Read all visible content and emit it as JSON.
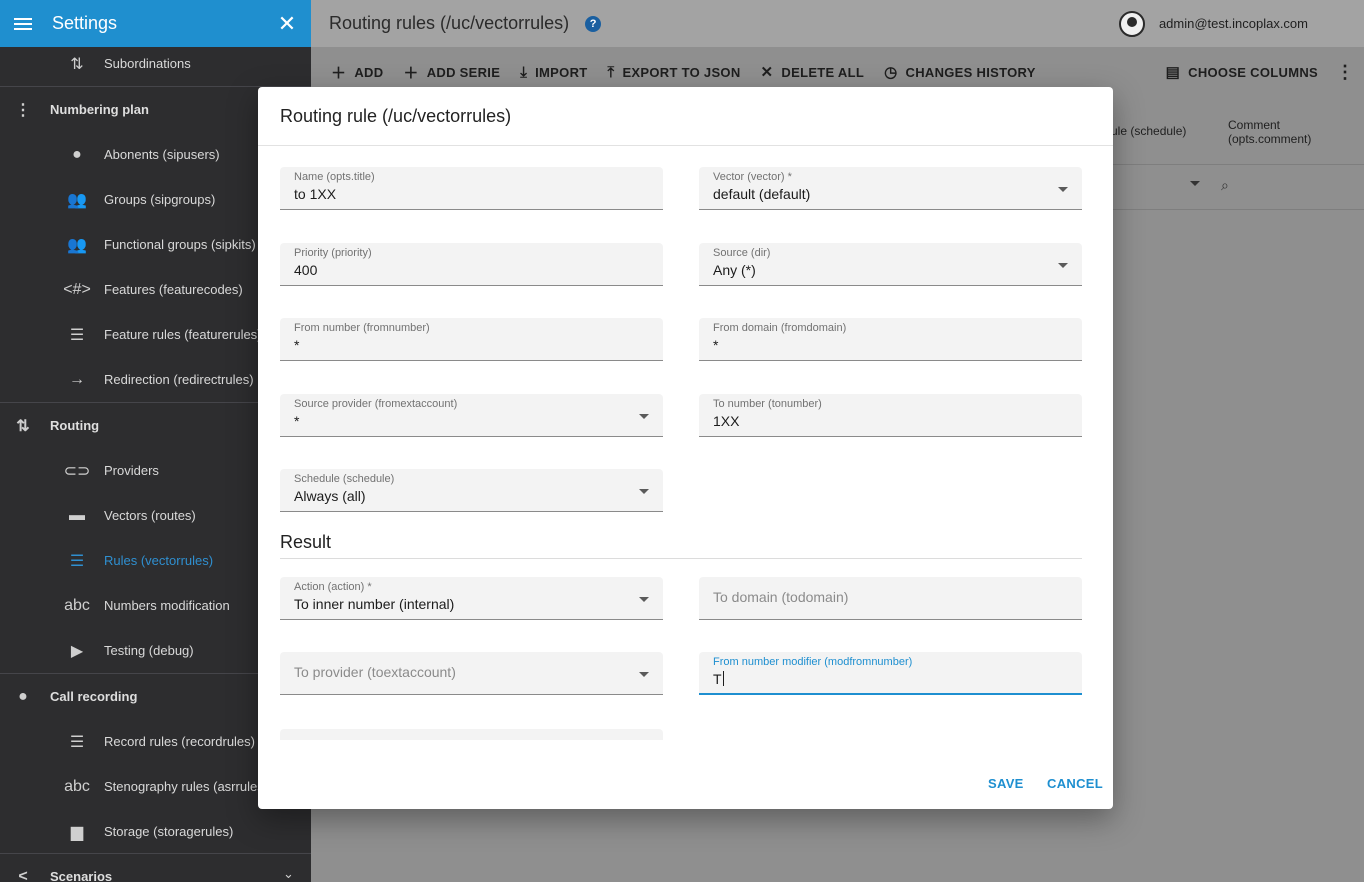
{
  "sidebar": {
    "title": "Settings",
    "items": [
      {
        "kind": "item",
        "label": "Subordinations",
        "icon": "sort-arrows-icon",
        "glyph": "⇅"
      },
      {
        "kind": "section",
        "label": "Numbering plan",
        "icon": "more-vertical-icon",
        "glyph": "⋮"
      },
      {
        "kind": "item",
        "label": "Abonents (sipusers)",
        "icon": "person-icon",
        "glyph": "●"
      },
      {
        "kind": "item",
        "label": "Groups (sipgroups)",
        "icon": "people-icon",
        "glyph": "👥"
      },
      {
        "kind": "item",
        "label": "Functional groups (sipkits)",
        "icon": "people-icon",
        "glyph": "👥"
      },
      {
        "kind": "item",
        "label": "Features (featurecodes)",
        "icon": "code-hash-icon",
        "glyph": "<#>"
      },
      {
        "kind": "item",
        "label": "Feature rules (featurerules)",
        "icon": "list-icon",
        "glyph": "☰"
      },
      {
        "kind": "item",
        "label": "Redirection (redirectrules)",
        "icon": "arrow-right-icon",
        "glyph": "→"
      },
      {
        "kind": "section",
        "label": "Routing",
        "icon": "sort-arrows-icon",
        "glyph": "⇅"
      },
      {
        "kind": "item",
        "label": "Providers",
        "icon": "link-icon",
        "glyph": "⊂⊃"
      },
      {
        "kind": "item",
        "label": "Vectors (routes)",
        "icon": "label-icon",
        "glyph": "▬"
      },
      {
        "kind": "item",
        "label": "Rules (vectorrules)",
        "icon": "list-icon",
        "glyph": "☰",
        "active": true
      },
      {
        "kind": "item",
        "label": "Numbers modification",
        "icon": "abc-icon",
        "glyph": "abc"
      },
      {
        "kind": "item",
        "label": "Testing (debug)",
        "icon": "play-circle-icon",
        "glyph": "▶"
      },
      {
        "kind": "section",
        "label": "Call recording",
        "icon": "record-icon",
        "glyph": "●"
      },
      {
        "kind": "item",
        "label": "Record rules (recordrules)",
        "icon": "list-icon",
        "glyph": "☰"
      },
      {
        "kind": "item",
        "label": "Stenography rules (asrrules)",
        "icon": "abc-icon",
        "glyph": "abc"
      },
      {
        "kind": "item",
        "label": "Storage (storagerules)",
        "icon": "storage-icon",
        "glyph": "▆"
      },
      {
        "kind": "section",
        "label": "Scenarios",
        "icon": "share-icon",
        "glyph": "<"
      }
    ]
  },
  "header": {
    "page_title": "Routing rules (/uc/vectorrules)",
    "help": "?",
    "user": "admin@test.incoplax.com"
  },
  "toolbar": {
    "add": "ADD",
    "add_serie": "ADD SERIE",
    "import": "IMPORT",
    "export": "EXPORT TO JSON",
    "delete_all": "DELETE ALL",
    "changes_history": "CHANGES HISTORY",
    "choose_columns": "CHOOSE COLUMNS"
  },
  "table": {
    "col_schedule": "ule (schedule)",
    "col_comment": "Comment (opts.comment)"
  },
  "dialog": {
    "title": "Routing rule (/uc/vectorrules)",
    "fields": {
      "name": {
        "label": "Name (opts.title)",
        "value": "to 1XX"
      },
      "vector": {
        "label": "Vector (vector) *",
        "value": "default (default)"
      },
      "priority": {
        "label": "Priority (priority)",
        "value": "400"
      },
      "source": {
        "label": "Source (dir)",
        "value": "Any (*)"
      },
      "from_number": {
        "label": "From number (fromnumber)",
        "value": "*"
      },
      "from_domain": {
        "label": "From domain (fromdomain)",
        "value": "*"
      },
      "source_provider": {
        "label": "Source provider (fromextaccount)",
        "value": "*"
      },
      "to_number": {
        "label": "To number (tonumber)",
        "value": "1XX"
      },
      "schedule": {
        "label": "Schedule (schedule)",
        "value": "Always (all)"
      },
      "action": {
        "label": "Action (action) *",
        "value": "To inner number (internal)"
      },
      "to_domain": {
        "placeholder": "To domain (todomain)"
      },
      "to_provider": {
        "placeholder": "To provider (toextaccount)"
      },
      "from_modifier": {
        "label": "From number modifier (modfromnumber)",
        "value": "T"
      }
    },
    "result_heading": "Result",
    "save": "SAVE",
    "cancel": "CANCEL"
  },
  "colors": {
    "accent": "#1e8fd0",
    "sidebar_bg": "#2d2d2f",
    "overlay": "#8f8f8f"
  }
}
